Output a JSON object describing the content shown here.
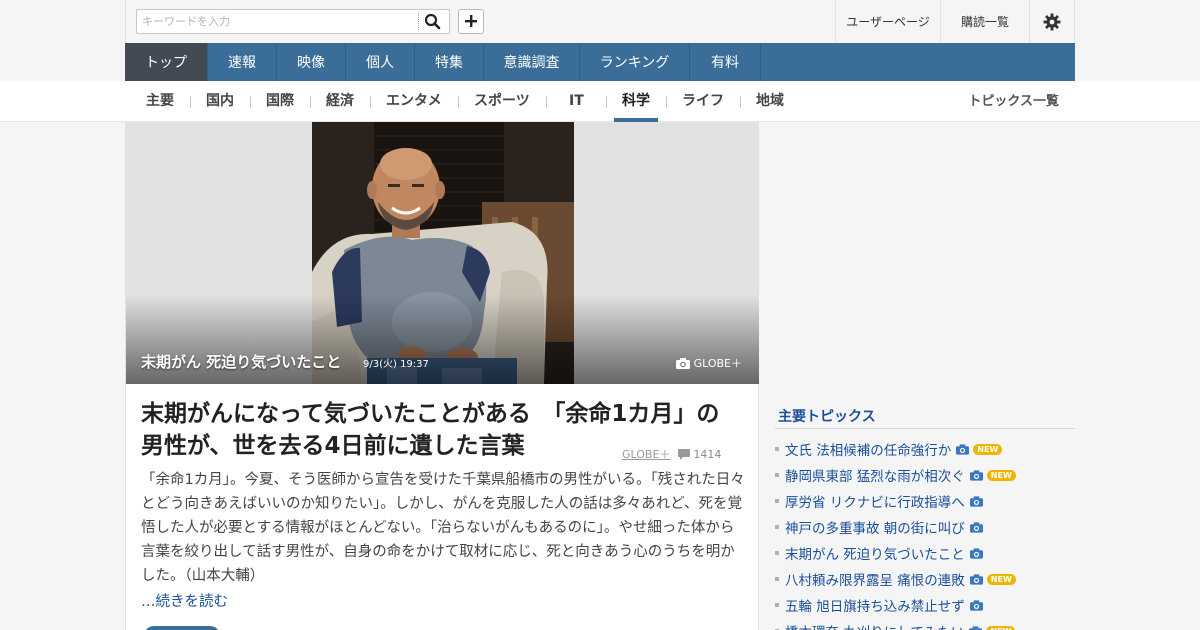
{
  "header": {
    "search": {
      "placeholder": "キーワードを入力",
      "value": ""
    },
    "user_page": "ユーザーページ",
    "subscriptions": "購読一覧"
  },
  "main_nav": [
    "トップ",
    "速報",
    "映像",
    "個人",
    "特集",
    "意識調査",
    "ランキング",
    "有料"
  ],
  "sub_nav": {
    "items": [
      "主要",
      "国内",
      "国際",
      "経済",
      "エンタメ",
      "スポーツ",
      "IT",
      "科学",
      "ライフ",
      "地域"
    ],
    "active": "科学",
    "topic_list": "トピックス一覧"
  },
  "hero": {
    "title": "末期がん 死迫り気づいたこと",
    "date": "9/3(火) 19:37",
    "source": "GLOBE＋"
  },
  "article": {
    "headline": "末期がんになって気づいたことがある　「余命1カ月」の男性が、世を去る4日前に遺した言葉",
    "source": "GLOBE＋",
    "comments": "1414",
    "lead": "「余命1カ月」。今夏、そう医師から宣告を受けた千葉県船橋市の男性がいる。「残された日々とどう向きあえばいいのか知りたい」。しかし、がんを克服した人の話は多々あれど、死を覚悟した人が必要とする情報がほとんどない。「治らないがんもあるのに」。やせ細った体から言葉を絞り出して話す男性が、自身の命をかけて取材に応じ、死と向きあう心のうちを明かした。（山本大輔）",
    "more": "…続きを読む"
  },
  "sidebar": {
    "heading": "主要トピックス",
    "new_label": "NEW",
    "topics": [
      {
        "title": "文氏 法相候補の任命強行か",
        "camera": true,
        "new": true
      },
      {
        "title": "静岡県東部 猛烈な雨が相次ぐ",
        "camera": true,
        "new": true
      },
      {
        "title": "厚労省 リクナビに行政指導へ",
        "camera": true,
        "new": false
      },
      {
        "title": "神戸の多重事故 朝の街に叫び",
        "camera": true,
        "new": false
      },
      {
        "title": "末期がん 死迫り気づいたこと",
        "camera": true,
        "new": false
      },
      {
        "title": "八村頼み限界露呈 痛恨の連敗",
        "camera": true,
        "new": true
      },
      {
        "title": "五輪 旭日旗持ち込み禁止せず",
        "camera": true,
        "new": false
      },
      {
        "title": "橋本環奈 丸刈りにしてみたい",
        "camera": true,
        "new": true
      }
    ]
  },
  "colors": {
    "nav": "#3a6e98",
    "nav_active": "#434a53",
    "link": "#1a4f9c",
    "new_badge": "#f0b400"
  },
  "icons": {
    "search": "search-icon",
    "add": "plus-icon",
    "settings": "gear-icon",
    "camera": "camera-icon",
    "comment": "comment-icon"
  }
}
